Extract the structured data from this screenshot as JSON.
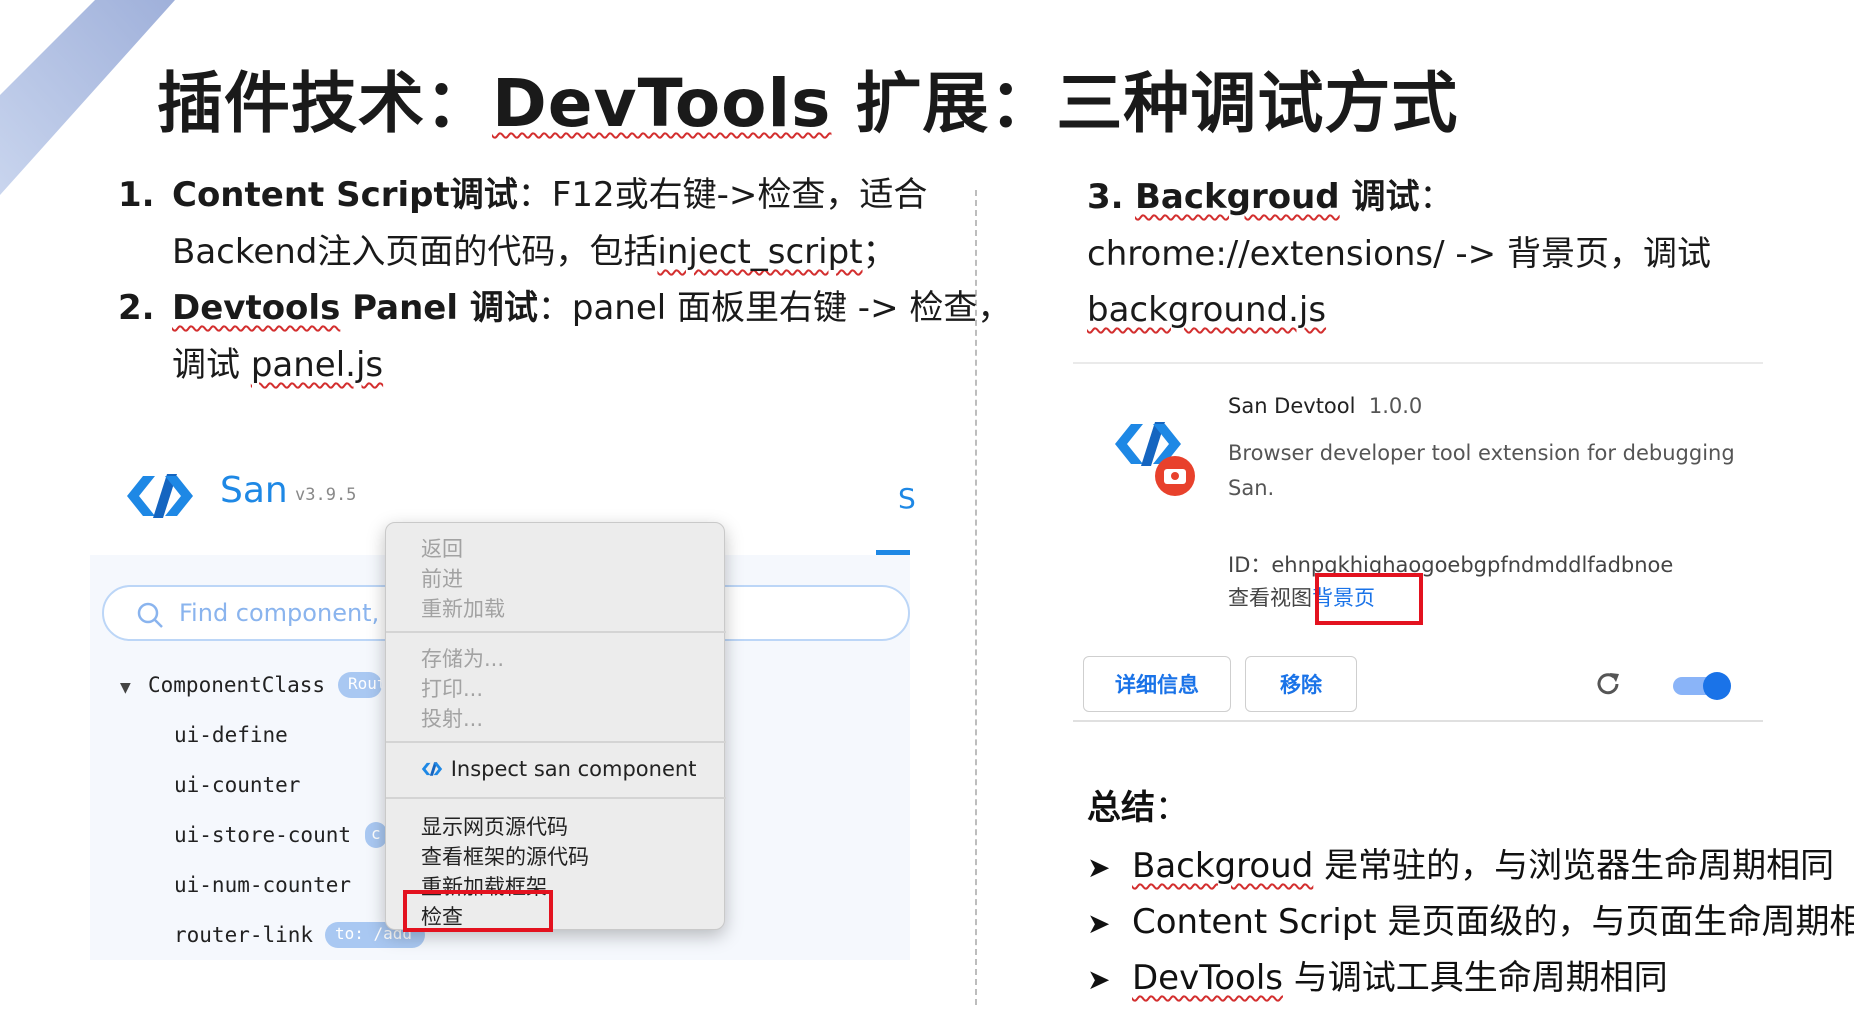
{
  "slide": {
    "title_prefix": "插件技术：",
    "title_devtools": "DevTools",
    "title_suffix": " 扩展：三种调试方式"
  },
  "left_text": {
    "item1_num": "1.",
    "item1_bold": "Content Script调试",
    "item1_rest": "：F12或右键->检查，适合",
    "item1_line2a": "Backend注入页面的代码，包括",
    "item1_line2b": "inject_script",
    "item1_line2c": "；",
    "item2_num": "2.",
    "item2_bold_a": "Devtools",
    "item2_bold_b": " Panel 调试",
    "item2_rest": "：panel 面板里右键 -> 检查，",
    "item2_line2a": "调试 ",
    "item2_line2b": "panel.js"
  },
  "san_devtools": {
    "name": "San",
    "version": "v3.9.5",
    "tab_glyph": "S",
    "search_placeholder": "Find component, f",
    "tree": [
      {
        "label": "ComponentClass",
        "badge": "Rout"
      },
      {
        "label": "ui-define",
        "badge": ""
      },
      {
        "label": "ui-counter",
        "badge": ""
      },
      {
        "label": "ui-store-count",
        "badge": "c"
      },
      {
        "label": "ui-num-counter",
        "badge": ""
      },
      {
        "label": "router-link",
        "badge": "to: /add"
      }
    ]
  },
  "context_menu": {
    "group1": [
      "返回",
      "前进",
      "重新加载"
    ],
    "group2": [
      "存储为...",
      "打印...",
      "投射..."
    ],
    "inspect_san": "Inspect san component",
    "group4": [
      "显示网页源代码",
      "查看框架的源代码",
      "重新加载框架",
      "检查"
    ]
  },
  "right_text": {
    "item3_num": "3.",
    "item3_bold_a": "Backgroud",
    "item3_bold_b": " 调试",
    "item3_colon": "：",
    "line2": "chrome://extensions/ -> 背景页，调试",
    "line3": "background.js"
  },
  "extension_card": {
    "name": "San Devtool",
    "version": "1.0.0",
    "description": "Browser developer tool extension for debugging San.",
    "id_label": "ID：",
    "id_value": "ehnpgkhighaogoebgpfndmddlfadbnoe",
    "view_label": "查看视图",
    "view_link": "背景页",
    "details_button": "详细信息",
    "remove_button": "移除",
    "enabled": true
  },
  "summary": {
    "title": "总结",
    "colon": "：",
    "items": [
      {
        "lead": "Backgroud",
        "rest": " 是常驻的，与浏览器生命周期相同"
      },
      {
        "lead": "Content Script",
        "rest": " 是页面级的，与页面生命周期相同"
      },
      {
        "lead": "DevTools",
        "rest": " 与调试工具生命周期相同"
      }
    ]
  },
  "colors": {
    "accent_blue": "#1e88e5",
    "link_blue": "#1a73e8",
    "highlight_red": "#e3121f",
    "corner_gradient_start": "#9fb0da",
    "corner_gradient_end": "#c9d5ee"
  }
}
